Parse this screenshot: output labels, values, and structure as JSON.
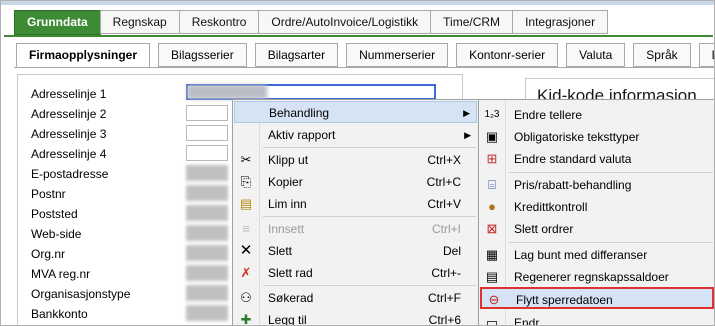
{
  "top_tabs": [
    "Grunndata",
    "Regnskap",
    "Reskontro",
    "Ordre/AutoInvoice/Logistikk",
    "Time/CRM",
    "Integrasjoner"
  ],
  "sub_tabs": [
    "Firmaopplysninger",
    "Bilagsserier",
    "Bilagsarter",
    "Nummerserier",
    "Kontonr-serier",
    "Valuta",
    "Språk",
    "Lar"
  ],
  "form_labels": [
    "Adresselinje 1",
    "Adresselinje 2",
    "Adresselinje 3",
    "Adresselinje 4",
    "E-postadresse",
    "Postnr",
    "Poststed",
    "Web-side",
    "Org.nr",
    "MVA reg.nr",
    "Organisasjonstype",
    "Bankkonto"
  ],
  "kid_title": "Kid-kode informasjon",
  "context_menu": {
    "items": [
      {
        "label": "Behandling",
        "shortcut": "",
        "icon": "",
        "submenu": true
      },
      {
        "label": "Aktiv rapport",
        "shortcut": "",
        "icon": "",
        "submenu": true
      },
      {
        "label": "Klipp ut",
        "shortcut": "Ctrl+X",
        "icon": "scissors-icon"
      },
      {
        "label": "Kopier",
        "shortcut": "Ctrl+C",
        "icon": "copy-icon"
      },
      {
        "label": "Lim inn",
        "shortcut": "Ctrl+V",
        "icon": "paste-icon"
      },
      {
        "label": "Innsett",
        "shortcut": "Ctrl+I",
        "icon": "insert-icon",
        "disabled": true
      },
      {
        "label": "Slett",
        "shortcut": "Del",
        "icon": "delete-icon"
      },
      {
        "label": "Slett rad",
        "shortcut": "Ctrl+-",
        "icon": "delete-row-icon"
      },
      {
        "label": "Søkerad",
        "shortcut": "Ctrl+F",
        "icon": "binoculars-icon"
      },
      {
        "label": "Legg til",
        "shortcut": "Ctrl+6",
        "icon": "add-icon"
      }
    ]
  },
  "submenu": {
    "items": [
      {
        "label": "Endre tellere",
        "icon": "counter-icon"
      },
      {
        "label": "Obligatoriske teksttyper",
        "icon": "text-types-icon"
      },
      {
        "label": "Endre standard valuta",
        "icon": "currency-icon"
      },
      {
        "label": "Pris/rabatt-behandling",
        "icon": "price-icon"
      },
      {
        "label": "Kredittkontroll",
        "icon": "credit-icon"
      },
      {
        "label": "Slett ordrer",
        "icon": "delete-orders-icon"
      },
      {
        "label": "Lag bunt med differanser",
        "icon": "batch-icon"
      },
      {
        "label": "Regenerer regnskapssaldoer",
        "icon": "regenerate-icon"
      },
      {
        "label": "Flytt sperredatoen",
        "icon": "lock-date-icon"
      },
      {
        "label": "Endr",
        "icon": "edit-icon"
      }
    ]
  }
}
